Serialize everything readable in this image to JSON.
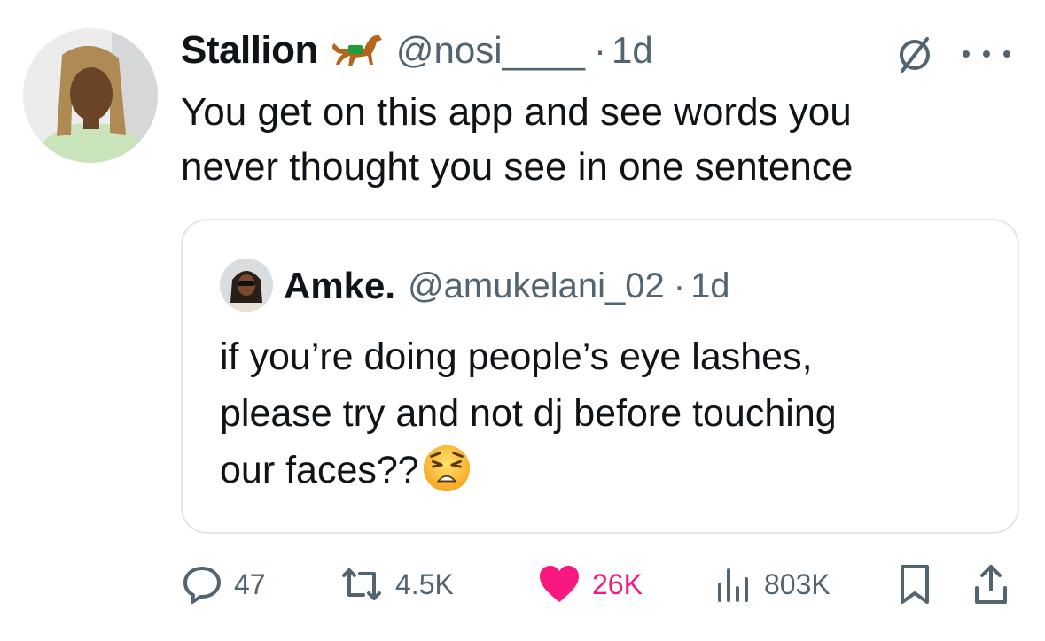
{
  "tweet": {
    "author": {
      "display_name": "Stallion",
      "name_emoji": "horse-icon",
      "handle": "@nosi____",
      "separator": "·",
      "time": "1d"
    },
    "text_lines": [
      "You get on this app and see words you",
      "never thought you see in one sentence"
    ],
    "icons": [
      "edit-icon",
      "more-icon"
    ]
  },
  "quote": {
    "display_name": "Amke.",
    "handle": "@amukelani_02",
    "separator": "·",
    "time": "1d",
    "text_lines": [
      "if you’re doing people’s eye lashes,",
      "please try and not dj before touching",
      "our faces??"
    ],
    "emoji": "weary-face-emoji"
  },
  "actions": {
    "replies": "47",
    "reposts": "4.5K",
    "likes": "26K",
    "views": "803K"
  },
  "colors": {
    "text": "#0f1419",
    "muted": "#536471",
    "border": "#e2e6e9",
    "like": "#f91880",
    "horse_saddle": "#1f9d3a"
  }
}
